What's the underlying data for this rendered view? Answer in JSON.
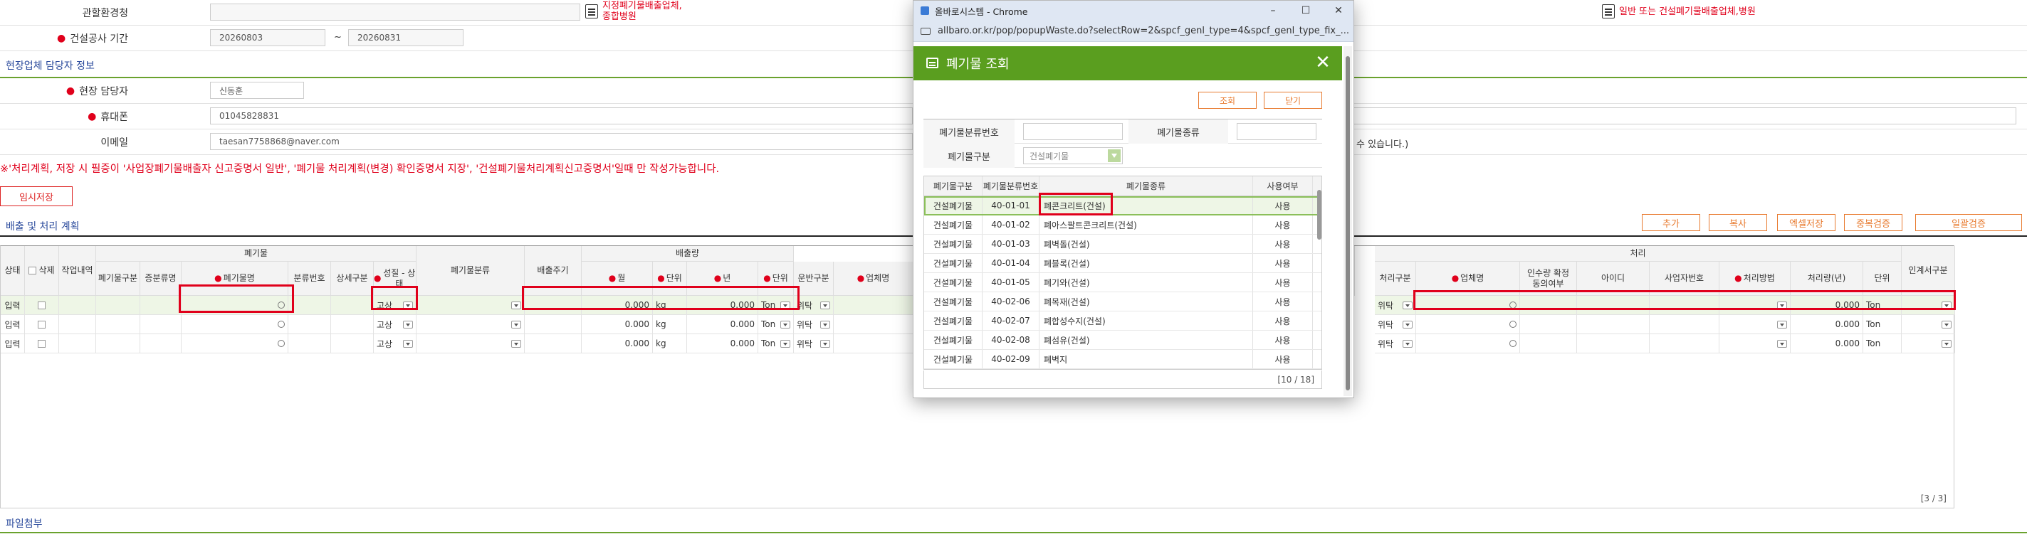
{
  "form": {
    "office_label": "관할환경청",
    "period_label": "건설공사 기간",
    "period_start": "20260803",
    "period_sep": "~",
    "period_end": "20260831",
    "link_designated": "지정폐기물배출업체,\n종합병원",
    "link_general": "일반 또는 건설폐기물배출업체,병원",
    "manager_section": "현장업체 담당자 정보",
    "manager_label": "현장 담당자",
    "manager_value": "신동훈",
    "phone_label": "휴대폰",
    "phone_value": "01045828831",
    "email_label": "이메일",
    "email_value": "taesan7758868@naver.com",
    "email_note": "수 있습니다.)",
    "notice": "※'처리계획, 저장 시 필증이 '사업장폐기물배출자 신고증명서 일반', '폐기물 처리계획(변경) 확인증명서 지장', '건설폐기물처리계획신고증명서'일때 만 작성가능합니다.",
    "temp_save": "임시저장",
    "plan_section": "배출 및 처리 계획"
  },
  "actions": {
    "add": "추가",
    "copy": "복사",
    "excel": "엑셀저장",
    "dup_check": "중복검증",
    "bulk_check": "일괄검증"
  },
  "grid": {
    "group_waste": "폐기물",
    "group_emission": "배출량",
    "group_process": "처리",
    "headers": {
      "status": "상태",
      "delete": "삭제",
      "work": "작업내역",
      "waste_type": "폐기물구분",
      "certificate": "증분류명",
      "waste_name": "폐기물명",
      "class_no": "분류번호",
      "detail": "상세구분",
      "nature": "성질 - 상태",
      "waste_class": "폐기물분류",
      "cycle": "배출주기",
      "month": "월",
      "unit1": "단위",
      "year": "년",
      "unit2": "단위",
      "transport": "운반구분",
      "company": "업체명",
      "process_type": "처리구분",
      "p_company": "업체명",
      "consent": "인수량 확정동의여부",
      "id": "아이디",
      "biz_no": "사업자번호",
      "method": "처리방법",
      "amount": "처리량(년)",
      "p_unit": "단위",
      "handover": "인계서구분"
    },
    "rows": [
      {
        "status": "입력",
        "nature": "고상",
        "month": "0.000",
        "unit1": "kg",
        "year": "0.000",
        "unit2": "Ton",
        "transport": "위탁",
        "process_type": "위탁",
        "amount": "0.000",
        "p_unit": "Ton"
      },
      {
        "status": "입력",
        "nature": "고상",
        "month": "0.000",
        "unit1": "kg",
        "year": "0.000",
        "unit2": "Ton",
        "transport": "위탁",
        "process_type": "위탁",
        "amount": "0.000",
        "p_unit": "Ton"
      },
      {
        "status": "입력",
        "nature": "고상",
        "month": "0.000",
        "unit1": "kg",
        "year": "0.000",
        "unit2": "Ton",
        "transport": "위탁",
        "process_type": "위탁",
        "amount": "0.000",
        "p_unit": "Ton"
      }
    ],
    "count": "[3 / 3]"
  },
  "file_section": "파일첨부",
  "popup": {
    "window_title": "올바로시스템 - Chrome",
    "url": "allbaro.or.kr/pop/popupWaste.do?selectRow=2&spcf_genl_type=4&spcf_genl_type_fix_...",
    "minimize": "–",
    "maximize": "☐",
    "close_win": "✕",
    "title": "폐기물 조회",
    "close": "✕",
    "search_btn": "조회",
    "close_btn": "닫기",
    "label_class_no": "폐기물분류번호",
    "label_type": "폐기물종류",
    "label_category": "폐기물구분",
    "category_value": "건설폐기물",
    "columns": [
      "폐기물구분",
      "폐기물분류번호",
      "폐기물종류",
      "사용여부"
    ],
    "rows": [
      {
        "cat": "건설폐기물",
        "code": "40-01-01",
        "name": "폐콘크리트(건설)",
        "use": "사용"
      },
      {
        "cat": "건설폐기물",
        "code": "40-01-02",
        "name": "폐아스팔트콘크리트(건설)",
        "use": "사용"
      },
      {
        "cat": "건설폐기물",
        "code": "40-01-03",
        "name": "폐벽돌(건설)",
        "use": "사용"
      },
      {
        "cat": "건설폐기물",
        "code": "40-01-04",
        "name": "폐블록(건설)",
        "use": "사용"
      },
      {
        "cat": "건설폐기물",
        "code": "40-01-05",
        "name": "폐기와(건설)",
        "use": "사용"
      },
      {
        "cat": "건설폐기물",
        "code": "40-02-06",
        "name": "폐목재(건설)",
        "use": "사용"
      },
      {
        "cat": "건설폐기물",
        "code": "40-02-07",
        "name": "폐합성수지(건설)",
        "use": "사용"
      },
      {
        "cat": "건설폐기물",
        "code": "40-02-08",
        "name": "폐섬유(건설)",
        "use": "사용"
      },
      {
        "cat": "건설폐기물",
        "code": "40-02-09",
        "name": "폐벽지",
        "use": "사용"
      }
    ],
    "count": "[10 / 18]"
  }
}
